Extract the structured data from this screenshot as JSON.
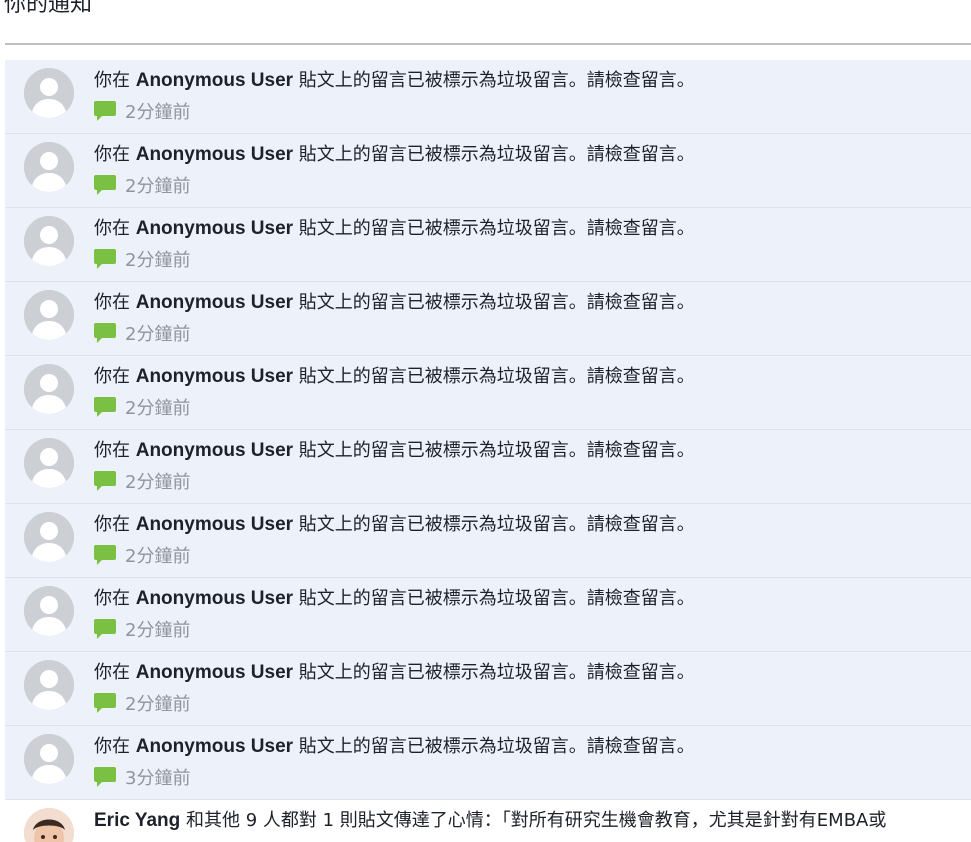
{
  "header": {
    "title": "你的通知"
  },
  "notifications": [
    {
      "prefix": "你在",
      "user": "Anonymous User",
      "suffix": "貼文上的留言已被標示為垃圾留言。請檢查留言。",
      "time": "2分鐘前"
    },
    {
      "prefix": "你在",
      "user": "Anonymous User",
      "suffix": "貼文上的留言已被標示為垃圾留言。請檢查留言。",
      "time": "2分鐘前"
    },
    {
      "prefix": "你在",
      "user": "Anonymous User",
      "suffix": "貼文上的留言已被標示為垃圾留言。請檢查留言。",
      "time": "2分鐘前"
    },
    {
      "prefix": "你在",
      "user": "Anonymous User",
      "suffix": "貼文上的留言已被標示為垃圾留言。請檢查留言。",
      "time": "2分鐘前"
    },
    {
      "prefix": "你在",
      "user": "Anonymous User",
      "suffix": "貼文上的留言已被標示為垃圾留言。請檢查留言。",
      "time": "2分鐘前"
    },
    {
      "prefix": "你在",
      "user": "Anonymous User",
      "suffix": "貼文上的留言已被標示為垃圾留言。請檢查留言。",
      "time": "2分鐘前"
    },
    {
      "prefix": "你在",
      "user": "Anonymous User",
      "suffix": "貼文上的留言已被標示為垃圾留言。請檢查留言。",
      "time": "2分鐘前"
    },
    {
      "prefix": "你在",
      "user": "Anonymous User",
      "suffix": "貼文上的留言已被標示為垃圾留言。請檢查留言。",
      "time": "2分鐘前"
    },
    {
      "prefix": "你在",
      "user": "Anonymous User",
      "suffix": "貼文上的留言已被標示為垃圾留言。請檢查留言。",
      "time": "2分鐘前"
    },
    {
      "prefix": "你在",
      "user": "Anonymous User",
      "suffix": "貼文上的留言已被標示為垃圾留言。請檢查留言。",
      "time": "3分鐘前"
    }
  ],
  "last_notification": {
    "user": "Eric Yang",
    "text": "和其他 9 人都對 1 則貼文傳達了心情：「對所有研究生機會教育，尤其是針對有EMBA或"
  },
  "colors": {
    "unread_bg": "#edf2fa",
    "comment_icon": "#7ac143",
    "time_text": "#90949c"
  },
  "icons": {
    "avatar": "default-avatar-icon",
    "comment": "comment-bubble-icon"
  }
}
